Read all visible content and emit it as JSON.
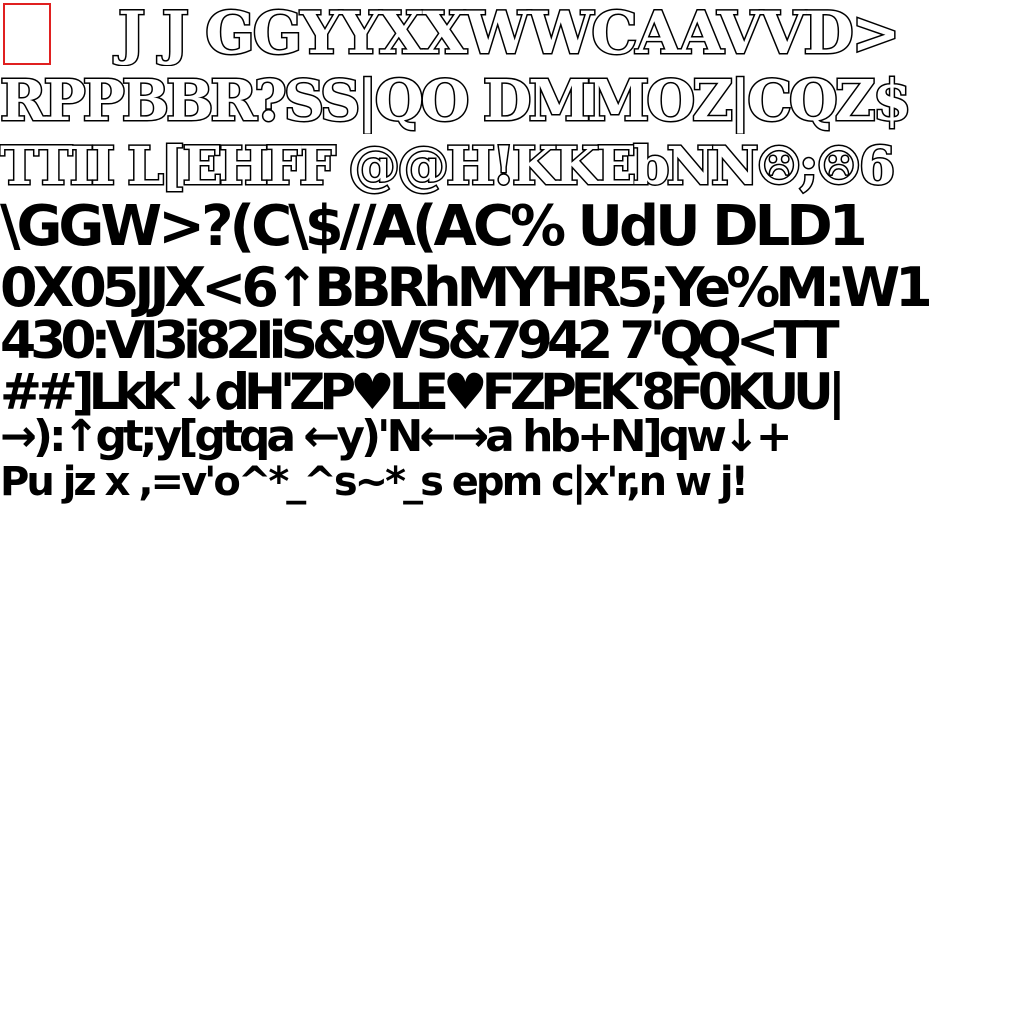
{
  "atlas": {
    "rows": [
      "J J GGYYXXWWCAAVVD>",
      "RPPBBR?SS|QO DMMOZ|CQZ$",
      "TTII L[EHFF @@H!KKEbNN☹;☹6",
      "\\GGW>?(C\\$//A(AC% UdU DLD1",
      "0X05JJX<6↑BBRhMYHR5;Ye%M:W1",
      "430:VI3i82IiS&9VS&7942 7'QQ<TT",
      "##]Lkk'↓dH'ZP♥LE♥FZPEK'8F0KUU|",
      "→):↑gt;y[gtqa ←y)'N←→a hb+N]qw↓+",
      "Pu jz x ,=v'o^*_^s~*_s epm c|x'r,n w j!"
    ]
  },
  "colors": {
    "marker": "#e02020",
    "ink": "#000000",
    "background": "#ffffff"
  }
}
